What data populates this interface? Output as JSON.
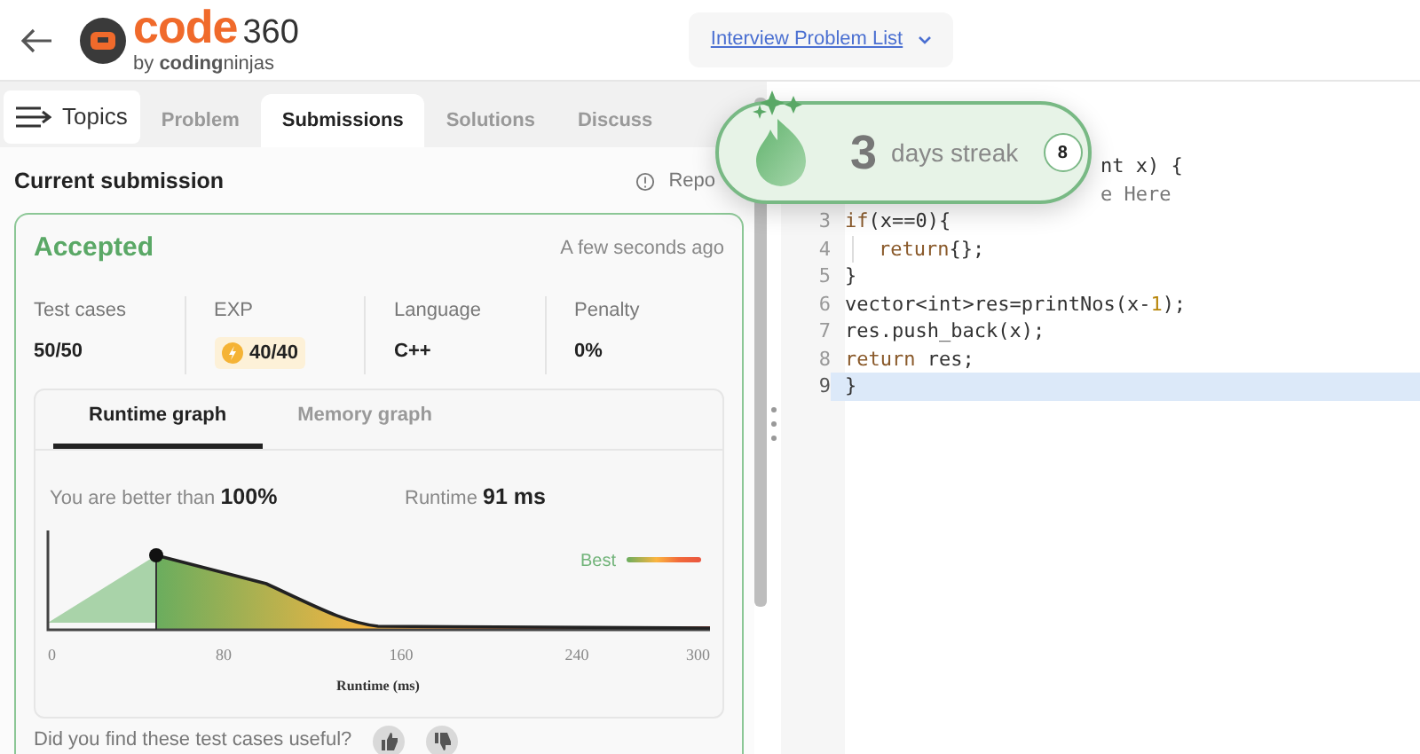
{
  "header": {
    "logo_word": "code",
    "logo_number": "360",
    "byline": "by **coding**ninjas",
    "problem_list": "Interview Problem List"
  },
  "topics_button": "Topics",
  "tabs": [
    {
      "label": "Problem",
      "selected": false
    },
    {
      "label": "Submissions",
      "selected": true
    },
    {
      "label": "Solutions",
      "selected": false
    },
    {
      "label": "Discuss",
      "selected": false
    }
  ],
  "submission": {
    "title": "Current submission",
    "report": "Repo",
    "status": "Accepted",
    "time": "A few seconds ago",
    "stats": [
      {
        "label": "Test cases",
        "value": "50/50",
        "kind": "plain"
      },
      {
        "label": "EXP",
        "value": "40/40",
        "kind": "exp"
      },
      {
        "label": "Language",
        "value": "C++",
        "kind": "plain"
      },
      {
        "label": "Penalty",
        "value": "0%",
        "kind": "plain"
      }
    ],
    "graph_tabs": [
      {
        "label": "Runtime graph",
        "selected": true
      },
      {
        "label": "Memory graph",
        "selected": false
      }
    ],
    "better_label": "You are better than",
    "better_value": "100%",
    "runtime_label": "Runtime",
    "runtime_value": "91 ms",
    "chart": {
      "legend": "Best",
      "x_ticks": [
        "0",
        "80",
        "160",
        "240",
        "300"
      ],
      "x_label": "Runtime (ms)"
    },
    "feedback": "Did you find these test cases useful?"
  },
  "streak": {
    "count": "3",
    "label": "days streak",
    "badge": "8"
  },
  "code": [
    {
      "highlighted": false,
      "tokens": [
        {
          "kind": "plain",
          "text": "nt x) {"
        }
      ]
    },
    {
      "highlighted": false,
      "tokens": [
        {
          "kind": "comment",
          "text": "e Here"
        }
      ]
    },
    {
      "number": "3",
      "highlighted": false,
      "tokens": [
        {
          "kind": "keyword",
          "text": "if"
        },
        {
          "kind": "plain",
          "text": "(x==0){"
        }
      ]
    },
    {
      "number": "4",
      "highlighted": false,
      "indented": true,
      "tokens": [
        {
          "kind": "keyword",
          "text": "return"
        },
        {
          "kind": "plain",
          "text": "{};"
        }
      ]
    },
    {
      "number": "5",
      "highlighted": false,
      "tokens": [
        {
          "kind": "plain",
          "text": "}"
        }
      ]
    },
    {
      "number": "6",
      "highlighted": false,
      "tokens": [
        {
          "kind": "plain",
          "text": "vector<int>res=printNos(x-"
        },
        {
          "kind": "number",
          "text": "1"
        },
        {
          "kind": "plain",
          "text": ");"
        }
      ]
    },
    {
      "number": "7",
      "highlighted": false,
      "tokens": [
        {
          "kind": "plain",
          "text": "res.push_back(x);"
        }
      ]
    },
    {
      "number": "8",
      "highlighted": false,
      "tokens": [
        {
          "kind": "keyword",
          "text": "return"
        },
        {
          "kind": "plain",
          "text": " res;"
        }
      ]
    },
    {
      "number": "9",
      "highlighted": true,
      "tokens": [
        {
          "kind": "plain",
          "text": "}"
        }
      ]
    }
  ]
}
